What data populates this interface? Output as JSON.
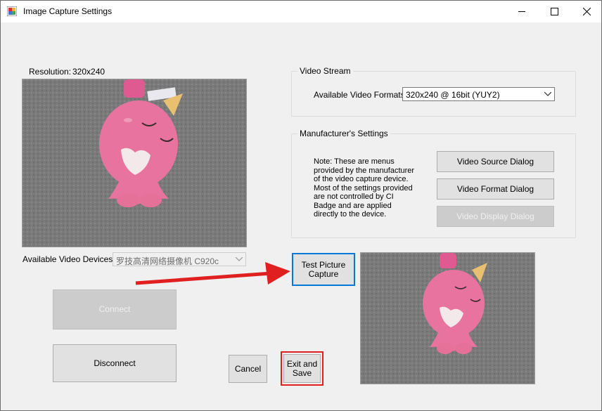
{
  "window": {
    "title": "Image Capture Settings",
    "controls": [
      "minimize-icon",
      "maximize-icon",
      "close-icon"
    ]
  },
  "left": {
    "resolution_label": "Resolution:",
    "resolution_value": "320x240",
    "devices_label": "Available Video Devices:",
    "devices_value": "罗技高清网络摄像机 C920c",
    "connect_label": "Connect",
    "disconnect_label": "Disconnect"
  },
  "video_stream": {
    "group_title": "Video Stream",
    "formats_label": "Available Video Formats:",
    "formats_value": "320x240 @ 16bit (YUY2)"
  },
  "manufacturer": {
    "group_title": "Manufacturer's Settings",
    "note_lines": [
      "Note:  These are menus",
      "provided by the manufacturer",
      "of the video capture device.",
      "Most of the settings provided",
      "are not controlled by CI",
      "Badge and are applied",
      "directly to the device."
    ],
    "video_source_label": "Video Source Dialog",
    "video_format_label": "Video Format Dialog",
    "video_display_label": "Video Display Dialog"
  },
  "actions": {
    "test_picture_label": [
      "Test Picture",
      "Capture"
    ],
    "cancel_label": "Cancel",
    "exit_save_label": [
      "Exit and",
      "Save"
    ]
  },
  "colors": {
    "annotation_red": "#e02020",
    "focus_blue": "#0078d7",
    "narwhal_pink": "#e8739e",
    "horn_gold": "#e8c070",
    "carpet_gray": "#7c7c7c"
  }
}
